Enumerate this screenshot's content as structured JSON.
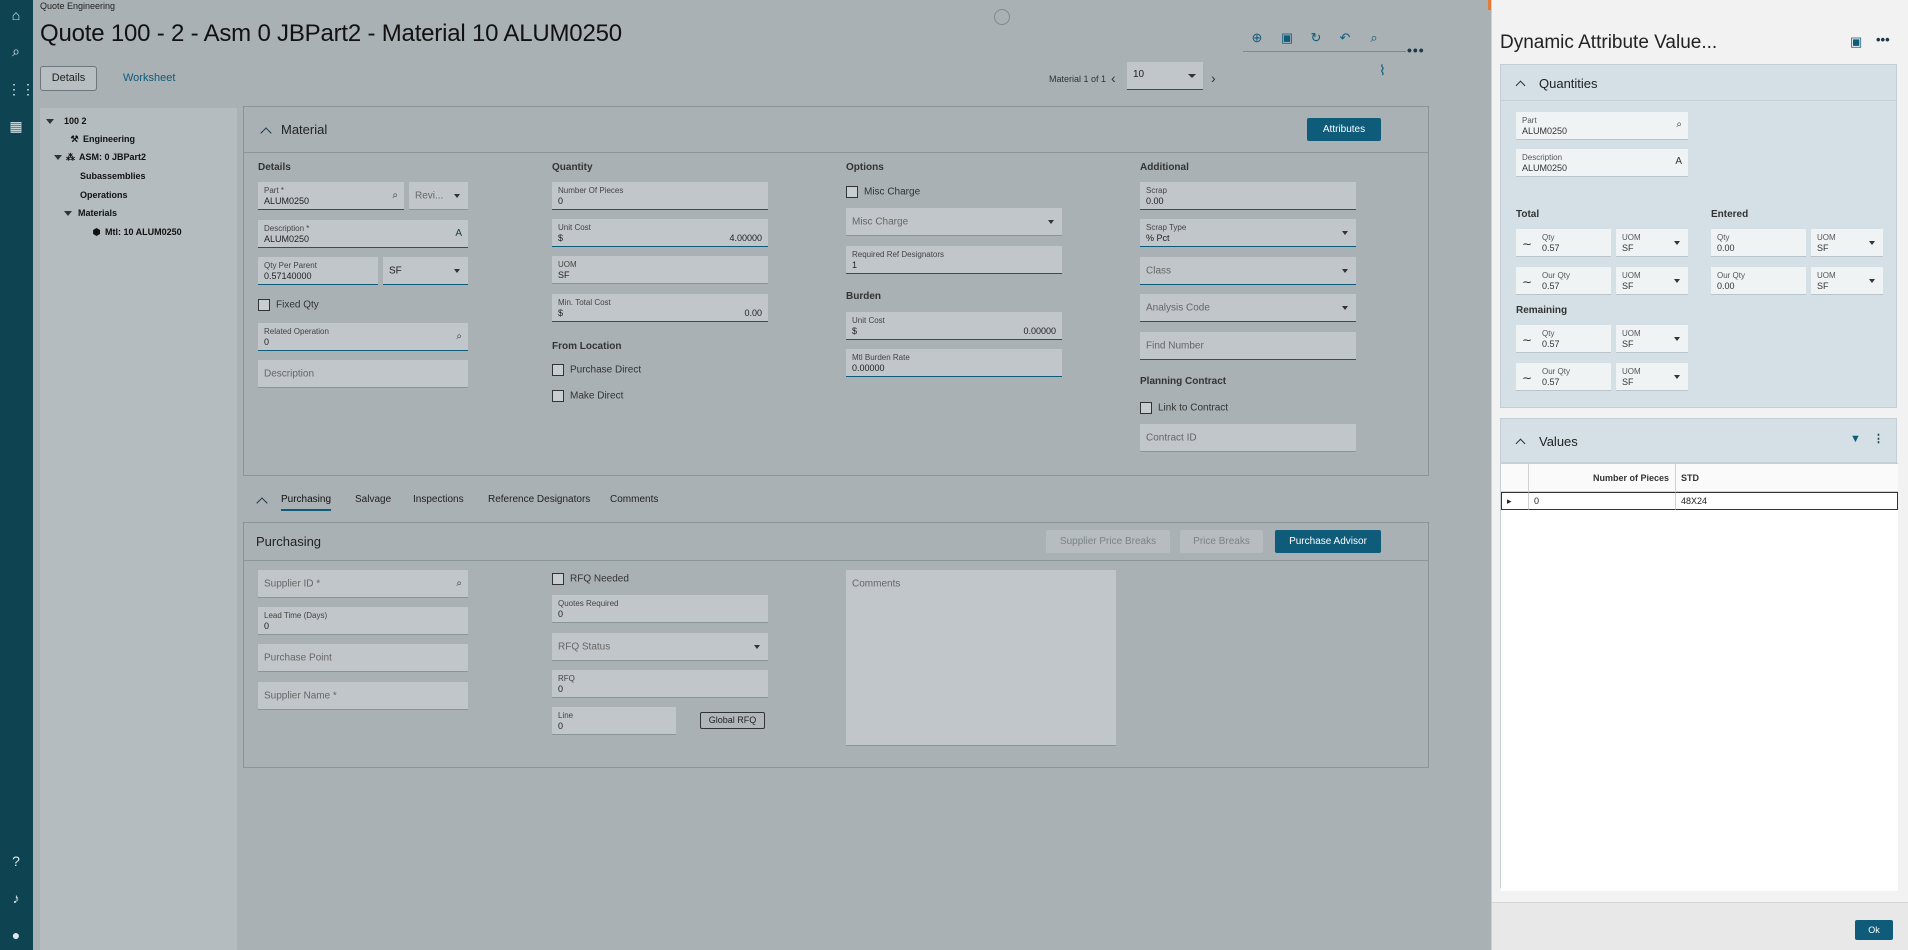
{
  "app": {
    "name": "Quote Engineering",
    "title": "Quote 100 - 2 - Asm 0 JBPart2 - Material 10 ALUM0250"
  },
  "tabs": {
    "details": "Details",
    "worksheet": "Worksheet"
  },
  "pager": {
    "label": "Material 1 of 1",
    "value": "10"
  },
  "tree": {
    "root": "100 2",
    "engineering": "Engineering",
    "asm": "ASM: 0 JBPart2",
    "subassemblies": "Subassemblies",
    "operations": "Operations",
    "materials": "Materials",
    "material_item": "Mtl: 10 ALUM0250"
  },
  "material": {
    "title": "Material",
    "attributes_button": "Attributes",
    "details": {
      "label": "Details",
      "part_label": "Part *",
      "part_value": "ALUM0250",
      "revision_placeholder": "Revi...",
      "description_label": "Description *",
      "description_value": "ALUM0250",
      "qty_per_parent_label": "Qty Per Parent",
      "qty_per_parent_value": "0.57140000",
      "uom_value": "SF",
      "fixed_qty": "Fixed Qty",
      "related_operation_label": "Related Operation",
      "related_operation_value": "0",
      "description_placeholder": "Description"
    },
    "quantity": {
      "label": "Quantity",
      "num_pieces_label": "Number Of Pieces",
      "num_pieces_value": "0",
      "unit_cost_label": "Unit Cost",
      "unit_cost_currency": "$",
      "unit_cost_value": "4.00000",
      "uom_label": "UOM",
      "uom_value": "SF",
      "min_total_cost_label": "Min. Total Cost",
      "min_total_cost_currency": "$",
      "min_total_cost_value": "0.00",
      "from_location": "From Location",
      "purchase_direct": "Purchase Direct",
      "make_direct": "Make Direct"
    },
    "options": {
      "label": "Options",
      "misc_charge_check": "Misc Charge",
      "misc_charge_select": "Misc Charge",
      "req_ref_label": "Required Ref Designators",
      "req_ref_value": "1",
      "burden": "Burden",
      "burden_unit_cost_label": "Unit Cost",
      "burden_unit_cost_currency": "$",
      "burden_unit_cost_value": "0.00000",
      "mtl_burden_rate_label": "Mtl Burden Rate",
      "mtl_burden_rate_value": "0.00000"
    },
    "additional": {
      "label": "Additional",
      "scrap_label": "Scrap",
      "scrap_value": "0.00",
      "scrap_type_label": "Scrap Type",
      "scrap_type_value": "% Pct",
      "class_placeholder": "Class",
      "analysis_code_placeholder": "Analysis Code",
      "find_number_placeholder": "Find Number",
      "planning_contract": "Planning Contract",
      "link_to_contract": "Link to Contract",
      "contract_id_placeholder": "Contract ID"
    }
  },
  "subtabs": [
    "Purchasing",
    "Salvage",
    "Inspections",
    "Reference Designators",
    "Comments"
  ],
  "purchasing": {
    "title": "Purchasing",
    "supplier_price_breaks": "Supplier Price Breaks",
    "price_breaks": "Price Breaks",
    "purchase_advisor": "Purchase Advisor",
    "supplier_id_placeholder": "Supplier ID *",
    "lead_time_label": "Lead Time (Days)",
    "lead_time_value": "0",
    "purchase_point_placeholder": "Purchase Point",
    "supplier_name_placeholder": "Supplier Name *",
    "rfq_needed": "RFQ Needed",
    "quotes_required_label": "Quotes Required",
    "quotes_required_value": "0",
    "rfq_status_placeholder": "RFQ Status",
    "rfq_label": "RFQ",
    "rfq_value": "0",
    "line_label": "Line",
    "line_value": "0",
    "global_rfq": "Global RFQ",
    "comments_placeholder": "Comments"
  },
  "drawer": {
    "title": "Dynamic Attribute Value...",
    "quantities": {
      "title": "Quantities",
      "part_label": "Part",
      "part_value": "ALUM0250",
      "description_label": "Description",
      "description_value": "ALUM0250",
      "total": "Total",
      "entered": "Entered",
      "remaining": "Remaining",
      "qty_label": "Qty",
      "our_qty_label": "Our Qty",
      "uom_label": "UOM",
      "uom_value": "SF",
      "total_qty": "0.57",
      "total_our_qty": "0.57",
      "entered_qty": "0.00",
      "entered_our_qty": "0.00",
      "remaining_qty": "0.57",
      "remaining_our_qty": "0.57"
    },
    "values": {
      "title": "Values",
      "columns": [
        "Number of Pieces",
        "STD"
      ],
      "rows": [
        [
          "0",
          "48X24"
        ]
      ]
    },
    "ok": "Ok"
  }
}
